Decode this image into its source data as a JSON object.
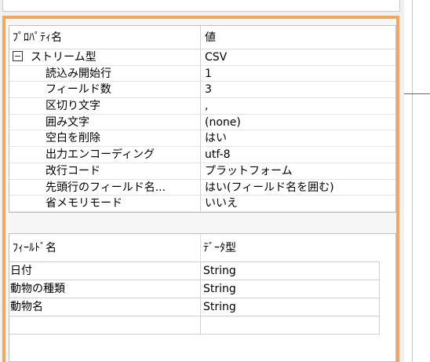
{
  "property_grid": {
    "header": {
      "name": "ﾌﾟﾛﾊﾟﾃｨ名",
      "value": "値"
    },
    "rows": [
      {
        "name": "ストリーム型",
        "value": "CSV",
        "expander": true
      },
      {
        "name": "読込み開始行",
        "value": "1"
      },
      {
        "name": "フィールド数",
        "value": "3"
      },
      {
        "name": "区切り文字",
        "value": ","
      },
      {
        "name": "囲み文字",
        "value": "(none)"
      },
      {
        "name": "空白を削除",
        "value": "はい"
      },
      {
        "name": "出力エンコーディング",
        "value": "utf-8"
      },
      {
        "name": "改行コード",
        "value": "プラットフォーム"
      },
      {
        "name": "先頭行のフィールド名...",
        "value": "はい(フィールド名を囲む)"
      },
      {
        "name": "省メモリモード",
        "value": "いいえ"
      }
    ]
  },
  "field_grid": {
    "header": {
      "name": "ﾌｨｰﾙﾄﾞ名",
      "type": "ﾃﾞｰﾀ型"
    },
    "rows": [
      {
        "name": "日付",
        "type": "String"
      },
      {
        "name": "動物の種類",
        "type": "String"
      },
      {
        "name": "動物名",
        "type": "String"
      },
      {
        "name": "",
        "type": ""
      }
    ]
  }
}
